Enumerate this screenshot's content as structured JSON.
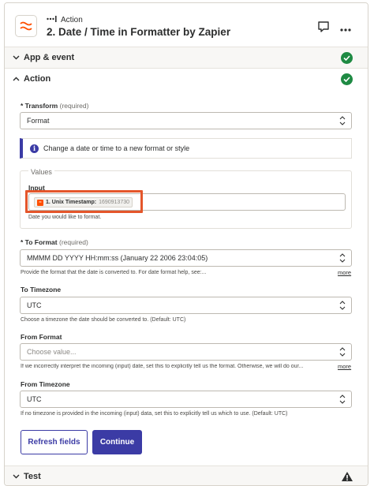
{
  "header": {
    "step_kind": "Action",
    "title": "2. Date / Time in Formatter by Zapier"
  },
  "sections": {
    "app_event": "App & event",
    "action": "Action",
    "test": "Test"
  },
  "form": {
    "transform": {
      "label": "Transform",
      "required": "(required)",
      "value": "Format"
    },
    "info": "Change a date or time to a new format or style",
    "values_legend": "Values",
    "input": {
      "label": "Input",
      "pill_label": "1. Unix Timestamp:",
      "pill_value": "1690913730",
      "help": "Date you would like to format."
    },
    "to_format": {
      "label": "To Format",
      "required": "(required)",
      "value": "MMMM DD YYYY HH:mm:ss (January 22 2006 23:04:05)",
      "help": "Provide the format that the date is converted to. For date format help, see:...",
      "more": "more"
    },
    "to_timezone": {
      "label": "To Timezone",
      "value": "UTC",
      "help": "Choose a timezone the date should be converted to. (Default: UTC)"
    },
    "from_format": {
      "label": "From Format",
      "placeholder": "Choose value...",
      "help": "If we incorrectly interpret the incoming (input) date, set this to explicitly tell us the format. Otherwise, we will do our...",
      "more": "more"
    },
    "from_timezone": {
      "label": "From Timezone",
      "value": "UTC",
      "help": "If no timezone is provided in the incoming (input) data, set this to explicitly tell us which to use. (Default: UTC)"
    }
  },
  "buttons": {
    "refresh": "Refresh fields",
    "continue": "Continue"
  },
  "colors": {
    "accent": "#3b3ba5",
    "success": "#1e8a43",
    "highlight": "#e4562b",
    "zapier_orange": "#ff4f00"
  },
  "icons": [
    "formatter-logo-icon",
    "step-dots-icon",
    "comment-icon",
    "more-options-icon",
    "chevron-down-icon",
    "chevron-up-icon",
    "check-circle-icon",
    "info-icon",
    "select-arrows-icon",
    "warning-icon"
  ]
}
